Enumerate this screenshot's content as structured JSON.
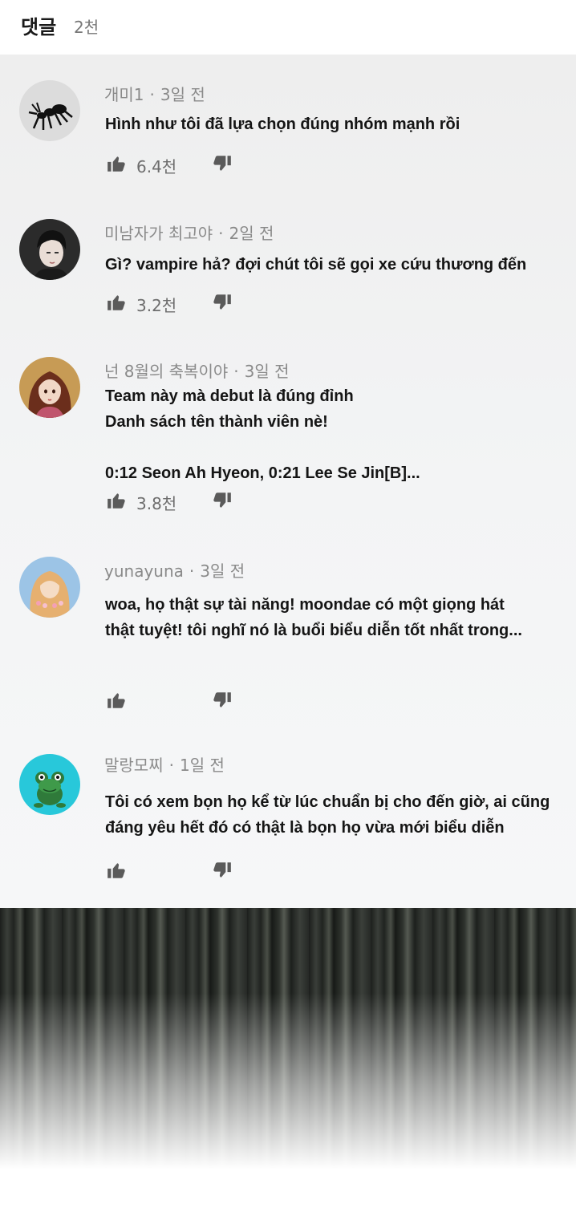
{
  "header": {
    "title": "댓글",
    "count": "2천"
  },
  "comments": [
    {
      "author": "개미1",
      "time": "3일 전",
      "text": "Hình như tôi đã lựa chọn đúng nhóm mạnh rồi",
      "likes": "6.4천"
    },
    {
      "author": "미남자가 최고야",
      "time": "2일 전",
      "text": "Gì? vampire hả? đợi chút tôi sẽ gọi xe cứu thương đến",
      "likes": "3.2천"
    },
    {
      "author": "넌 8월의 축복이야",
      "time": "3일 전",
      "text": "Team này mà debut là đúng đỉnh\nDanh sách tên thành viên nè!\n\n0:12 Seon Ah Hyeon, 0:21 Lee Se Jin[B]...",
      "likes": "3.8천"
    },
    {
      "author": "yunayuna",
      "time": "3일 전",
      "text": "woa, họ thật sự tài năng! moondae có một giọng hát\nthật tuyệt! tôi nghĩ nó là buổi biểu diễn tốt nhất trong...",
      "likes": ""
    },
    {
      "author": "말랑모찌",
      "time": "1일 전",
      "text": "Tôi có xem bọn họ kể từ lúc chuẩn bị cho đến giờ, ai cũng\nđáng yêu hết đó có thật là bọn họ vừa mới biểu diễn",
      "likes": ""
    }
  ],
  "separator": "·",
  "colors": {
    "accent_text": "#151515",
    "meta_text": "#8a8a8a",
    "icon": "#5a5a5a"
  }
}
